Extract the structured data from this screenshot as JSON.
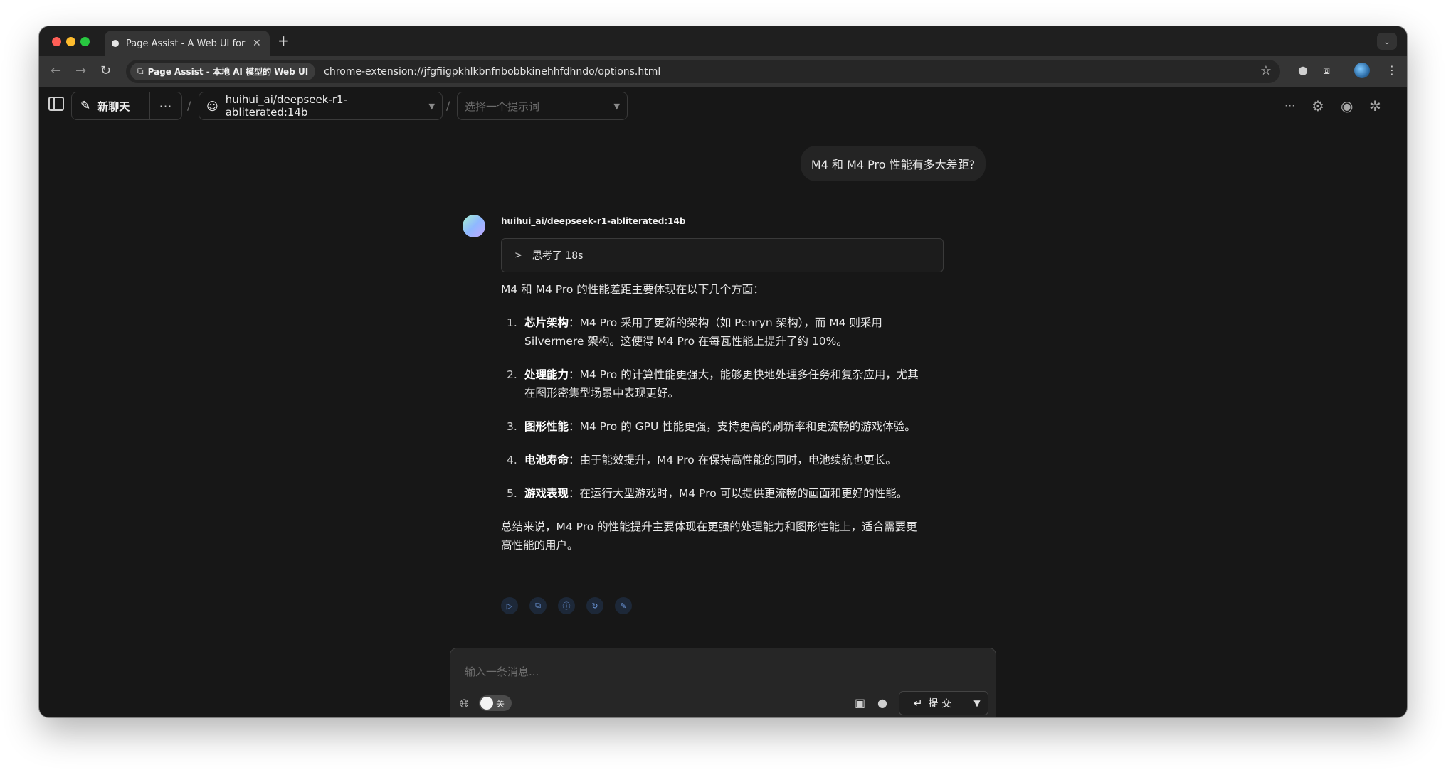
{
  "browser": {
    "tab_title": "Page Assist - A Web UI for Lo",
    "tab_close": "✕",
    "new_tab": "+",
    "tab_menu": "⌄",
    "site_chip": "Page Assist - 本地 AI 模型的 Web UI",
    "url": "chrome-extension://jfgfiigpkhlkbnfnbobbkinehhfdhndo/options.html"
  },
  "header": {
    "new_chat": "新聊天",
    "more": "···",
    "separator": "/",
    "model": "huihui_ai/deepseek-r1-abliterated:14b",
    "prompt_placeholder": "选择一个提示词",
    "icons": [
      "more-icon",
      "settings-icon",
      "github-icon",
      "gear-icon"
    ]
  },
  "chat": {
    "user_message": "M4 和 M4 Pro 性能有多大差距?",
    "assistant_model": "huihui_ai/deepseek-r1-abliterated:14b",
    "thinking": "思考了 18s",
    "intro": "M4 和 M4 Pro 的性能差距主要体现在以下几个方面：",
    "items": [
      {
        "num": "1.",
        "title": "芯片架构",
        "text": "：M4 Pro 采用了更新的架构（如 Penryn 架构），而 M4 则采用 Silvermere 架构。这使得 M4 Pro 在每瓦性能上提升了约 10%。"
      },
      {
        "num": "2.",
        "title": "处理能力",
        "text": "：M4 Pro 的计算性能更强大，能够更快地处理多任务和复杂应用，尤其在图形密集型场景中表现更好。"
      },
      {
        "num": "3.",
        "title": "图形性能",
        "text": "：M4 Pro 的 GPU 性能更强，支持更高的刷新率和更流畅的游戏体验。"
      },
      {
        "num": "4.",
        "title": "电池寿命",
        "text": "：由于能效提升，M4 Pro 在保持高性能的同时，电池续航也更长。"
      },
      {
        "num": "5.",
        "title": "游戏表现",
        "text": "：在运行大型游戏时，M4 Pro 可以提供更流畅的画面和更好的性能。"
      }
    ],
    "summary": "总结来说，M4 Pro 的性能提升主要体现在更强的处理能力和图形性能上，适合需要更高性能的用户。"
  },
  "composer": {
    "placeholder": "输入一条消息...",
    "toggle_label": "关",
    "submit": "提 交"
  },
  "colors": {
    "background": "#171717",
    "accent_icon": "#6f9be0",
    "close_dot": "#ff5f57",
    "min_dot": "#febc2e",
    "max_dot": "#28c840"
  }
}
